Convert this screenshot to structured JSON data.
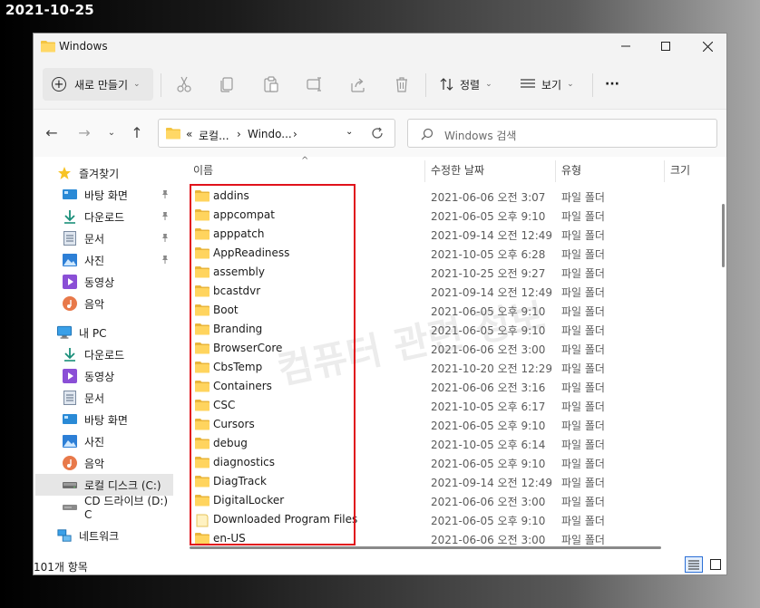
{
  "date_stamp": "2021-10-25",
  "window": {
    "title": "Windows",
    "controls": {
      "minimize": "minimize-icon",
      "maximize": "maximize-icon",
      "close": "close-icon"
    }
  },
  "toolbar": {
    "new_label": "새로 만들기",
    "sort_label": "정렬",
    "view_label": "보기",
    "more_label": "···"
  },
  "navbar": {
    "breadcrumb_prefix": "«",
    "breadcrumb_1": "로컬...",
    "breadcrumb_sep": "›",
    "breadcrumb_2": "Windo...",
    "breadcrumb_sep2": "›",
    "search_placeholder": "Windows 검색"
  },
  "sidebar": {
    "items": [
      {
        "label": "즐겨찾기",
        "icon": "star-icon"
      },
      {
        "label": "바탕 화면",
        "icon": "desktop-icon",
        "pinned": true
      },
      {
        "label": "다운로드",
        "icon": "download-icon",
        "pinned": true
      },
      {
        "label": "문서",
        "icon": "document-icon",
        "pinned": true
      },
      {
        "label": "사진",
        "icon": "pictures-icon",
        "pinned": true
      },
      {
        "label": "동영상",
        "icon": "video-icon"
      },
      {
        "label": "음악",
        "icon": "music-icon"
      },
      {
        "label": "내 PC",
        "icon": "pc-icon"
      },
      {
        "label": "다운로드",
        "icon": "download-icon"
      },
      {
        "label": "동영상",
        "icon": "video-icon"
      },
      {
        "label": "문서",
        "icon": "document-icon"
      },
      {
        "label": "바탕 화면",
        "icon": "desktop-icon"
      },
      {
        "label": "사진",
        "icon": "pictures-icon"
      },
      {
        "label": "음악",
        "icon": "music-icon"
      },
      {
        "label": "로컬 디스크 (C:)",
        "icon": "drive-icon",
        "selected": true
      },
      {
        "label": "CD 드라이브 (D:) C",
        "icon": "cd-drive-icon"
      },
      {
        "label": "네트워크",
        "icon": "network-icon"
      }
    ]
  },
  "columns": {
    "name": "이름",
    "date": "수정한 날짜",
    "type": "유형",
    "size": "크기"
  },
  "files": [
    {
      "name": "addins",
      "date": "2021-06-06 오전 3:07",
      "type": "파일 폴더"
    },
    {
      "name": "appcompat",
      "date": "2021-06-05 오후 9:10",
      "type": "파일 폴더"
    },
    {
      "name": "apppatch",
      "date": "2021-09-14 오전 12:49",
      "type": "파일 폴더"
    },
    {
      "name": "AppReadiness",
      "date": "2021-10-05 오후 6:28",
      "type": "파일 폴더"
    },
    {
      "name": "assembly",
      "date": "2021-10-25 오전 9:27",
      "type": "파일 폴더"
    },
    {
      "name": "bcastdvr",
      "date": "2021-09-14 오전 12:49",
      "type": "파일 폴더"
    },
    {
      "name": "Boot",
      "date": "2021-06-05 오후 9:10",
      "type": "파일 폴더"
    },
    {
      "name": "Branding",
      "date": "2021-06-05 오후 9:10",
      "type": "파일 폴더"
    },
    {
      "name": "BrowserCore",
      "date": "2021-06-06 오전 3:00",
      "type": "파일 폴더"
    },
    {
      "name": "CbsTemp",
      "date": "2021-10-20 오전 12:29",
      "type": "파일 폴더"
    },
    {
      "name": "Containers",
      "date": "2021-06-06 오전 3:16",
      "type": "파일 폴더"
    },
    {
      "name": "CSC",
      "date": "2021-10-05 오후 6:17",
      "type": "파일 폴더"
    },
    {
      "name": "Cursors",
      "date": "2021-06-05 오후 9:10",
      "type": "파일 폴더"
    },
    {
      "name": "debug",
      "date": "2021-10-05 오후 6:14",
      "type": "파일 폴더"
    },
    {
      "name": "diagnostics",
      "date": "2021-06-05 오후 9:10",
      "type": "파일 폴더"
    },
    {
      "name": "DiagTrack",
      "date": "2021-09-14 오전 12:49",
      "type": "파일 폴더"
    },
    {
      "name": "DigitalLocker",
      "date": "2021-06-06 오전 3:00",
      "type": "파일 폴더"
    },
    {
      "name": "Downloaded Program Files",
      "date": "2021-06-05 오후 9:10",
      "type": "파일 폴더",
      "special": true
    },
    {
      "name": "en-US",
      "date": "2021-06-06 오전 3:00",
      "type": "파일 폴더"
    }
  ],
  "watermark": "컴퓨터 관련 정보",
  "status": {
    "item_count": "101개 항목"
  },
  "colors": {
    "accent": "#2b6fd6",
    "highlight_border": "#e0121b",
    "folder": "#f4c542"
  }
}
